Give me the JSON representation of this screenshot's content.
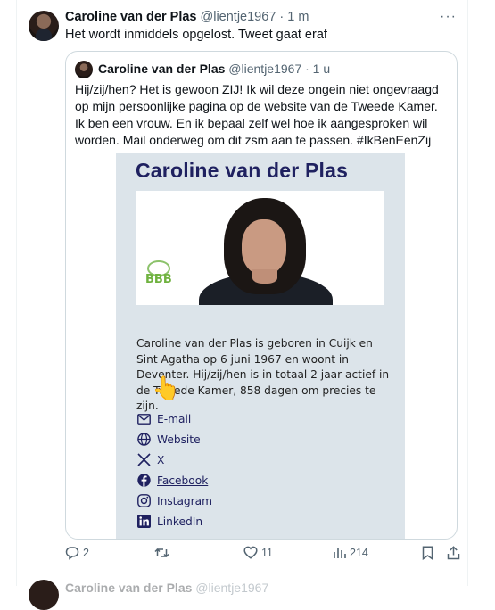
{
  "tweet": {
    "author_name": "Caroline van der Plas",
    "handle": "@lientje1967",
    "time": "· 1 m",
    "text": "Het wordt inmiddels opgelost. Tweet gaat eraf"
  },
  "quote": {
    "author_name": "Caroline van der Plas",
    "handle": "@lientje1967",
    "time": "· 1 u",
    "text": "Hij/zij/hen? Het is gewoon ZIJ! Ik wil deze ongein niet ongevraagd op mijn persoonlijke pagina op de website van de Tweede Kamer. Ik ben een vrouw. En ik bepaal zelf wel hoe ik aangesproken wil worden. Mail onderweg om dit zsm aan te passen. #IkBenEenZij"
  },
  "card": {
    "title": "Caroline van der Plas",
    "logo_text": "BBB",
    "bio": "Caroline van der Plas is geboren in Cuijk en Sint Agatha op 6 juni 1967 en woont in Deventer. Hij/zij/hen is in totaal 2 jaar actief in de Tweede Kamer, 858 dagen om precies te zijn.",
    "links": [
      {
        "label": "E-mail",
        "icon": "mail-icon"
      },
      {
        "label": "Website",
        "icon": "globe-icon"
      },
      {
        "label": "X",
        "icon": "x-logo-icon"
      },
      {
        "label": "Facebook",
        "icon": "facebook-icon"
      },
      {
        "label": "Instagram",
        "icon": "instagram-icon"
      },
      {
        "label": "LinkedIn",
        "icon": "linkedin-icon"
      }
    ]
  },
  "actions": {
    "replies": "2",
    "retweets": "",
    "likes": "11",
    "views": "214"
  },
  "next_tweet": {
    "author_name": "Caroline van der Plas",
    "handle": "@lientje1967"
  },
  "colors": {
    "text": "#0f1419",
    "muted": "#536471",
    "card_bg": "#dce4ea",
    "card_title": "#1f2160"
  }
}
